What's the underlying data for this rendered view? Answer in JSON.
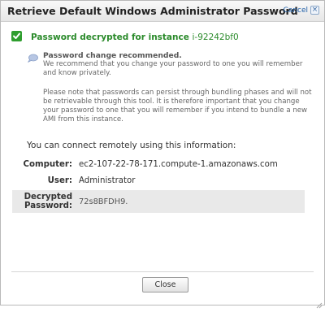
{
  "dialog": {
    "title": "Retrieve Default Windows Administrator Password",
    "cancel_label": "Cancel",
    "cancel_icon": "close-icon"
  },
  "success": {
    "icon": "checkmark-icon",
    "message": "Password decrypted for instance",
    "instance_id": "i-92242bf0"
  },
  "notice": {
    "icon": "speech-bubble-icon",
    "title": "Password change recommended.",
    "paragraph_1": "We recommend that you change your password to one you will remember and know privately.",
    "paragraph_2": "Please note that passwords can persist through bundling phases and will not be retrievable through this tool. It is therefore important that you change your password to one that you will remember if you intend to bundle a new AMI from this instance."
  },
  "connection": {
    "intro": "You can connect remotely using this information:",
    "computer_label": "Computer:",
    "computer_value": "ec2-107-22-78-171.compute-1.amazonaws.com",
    "user_label": "User:",
    "user_value": "Administrator",
    "password_label": "Decrypted Password:",
    "password_value": "72s8BFDH9."
  },
  "footer": {
    "close_label": "Close"
  },
  "colors": {
    "success_green": "#2a8a2a",
    "link_blue": "#1f5fa8",
    "password_row_bg": "#e9e9e9"
  }
}
